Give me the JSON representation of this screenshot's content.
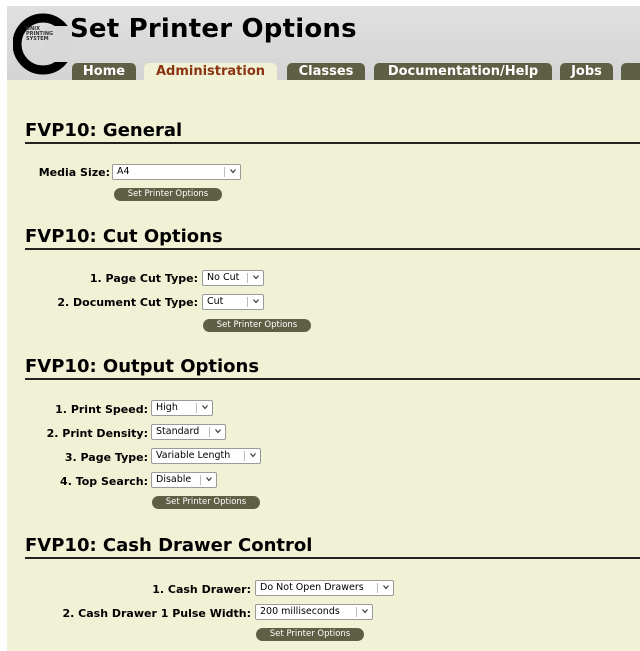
{
  "header": {
    "title": "Set Printer Options",
    "logo_text": [
      "UNIX",
      "PRINTING",
      "SYSTEM"
    ]
  },
  "tabs": [
    {
      "label": "Home",
      "active": false
    },
    {
      "label": "Administration",
      "active": true
    },
    {
      "label": "Classes",
      "active": false
    },
    {
      "label": "Documentation/Help",
      "active": false
    },
    {
      "label": "Jobs",
      "active": false
    },
    {
      "label": "",
      "active": false
    }
  ],
  "sections": {
    "general": {
      "title": "FVP10: General",
      "media_size": {
        "label": "Media Size:",
        "value": "A4"
      },
      "submit": "Set Printer Options"
    },
    "cut": {
      "title": "FVP10: Cut Options",
      "page_cut": {
        "label": "1. Page Cut Type:",
        "value": "No Cut"
      },
      "doc_cut": {
        "label": "2. Document Cut Type:",
        "value": "Cut"
      },
      "submit": "Set Printer Options"
    },
    "output": {
      "title": "FVP10: Output Options",
      "speed": {
        "label": "1. Print Speed:",
        "value": "High"
      },
      "density": {
        "label": "2. Print Density:",
        "value": "Standard"
      },
      "page_type": {
        "label": "3. Page Type:",
        "value": "Variable Length"
      },
      "top_search": {
        "label": "4. Top Search:",
        "value": "Disable"
      },
      "submit": "Set Printer Options"
    },
    "cash": {
      "title": "FVP10: Cash Drawer Control",
      "drawer": {
        "label": "1. Cash Drawer:",
        "value": "Do Not Open Drawers"
      },
      "pulse": {
        "label": "2. Cash Drawer 1 Pulse Width:",
        "value": "200 milliseconds"
      },
      "submit": "Set Printer Options"
    }
  },
  "colors": {
    "page_bg": "#f1f1d6",
    "tab_bg": "#5f5f45",
    "tab_active_text": "#8a3412",
    "button_bg": "#5f5f45"
  }
}
